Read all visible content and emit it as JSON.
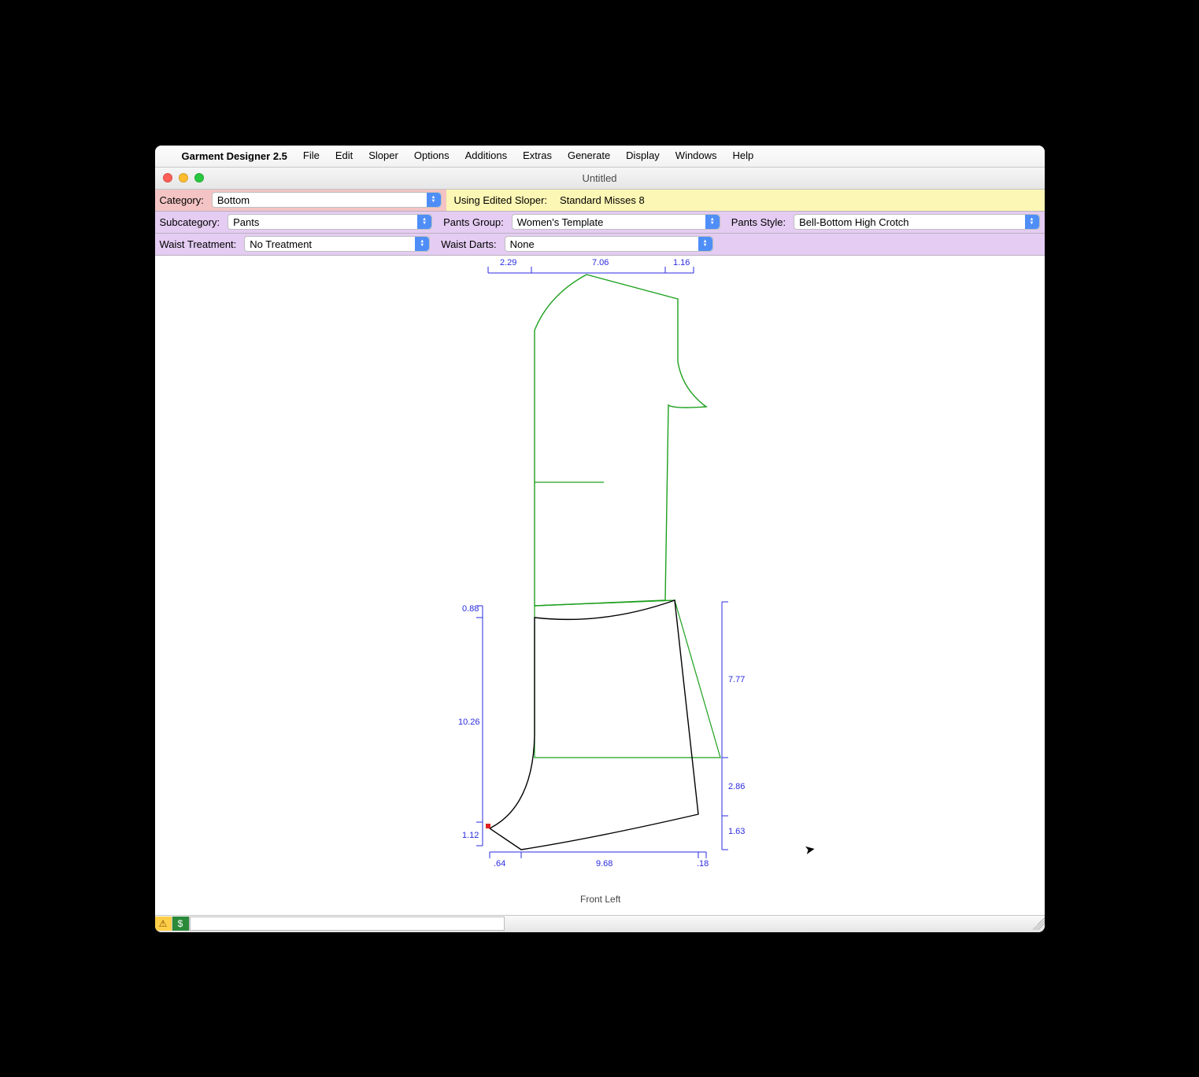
{
  "menubar": {
    "app": "Garment Designer 2.5",
    "items": [
      "File",
      "Edit",
      "Sloper",
      "Options",
      "Additions",
      "Extras",
      "Generate",
      "Display",
      "Windows",
      "Help"
    ]
  },
  "window": {
    "title": "Untitled"
  },
  "row1": {
    "category_label": "Category:",
    "category_value": "Bottom",
    "sloper_label": "Using Edited Sloper:",
    "sloper_value": "Standard Misses 8"
  },
  "row2": {
    "subcategory_label": "Subcategory:",
    "subcategory_value": "Pants",
    "pants_group_label": "Pants Group:",
    "pants_group_value": "Women's Template",
    "pants_style_label": "Pants Style:",
    "pants_style_value": "Bell-Bottom High Crotch"
  },
  "row3": {
    "waist_treatment_label": "Waist Treatment:",
    "waist_treatment_value": "No Treatment",
    "waist_darts_label": "Waist Darts:",
    "waist_darts_value": "None"
  },
  "measurements": {
    "top_a": "2.29",
    "top_b": "7.06",
    "top_c": "1.16",
    "left_a": "0.88",
    "left_b": "10.26",
    "left_c": "1.12",
    "right_a": "7.77",
    "right_b": "2.86",
    "right_c": "1.63",
    "bot_a": ".64",
    "bot_b": "9.68",
    "bot_c": ".18"
  },
  "section_label": "Front Left"
}
